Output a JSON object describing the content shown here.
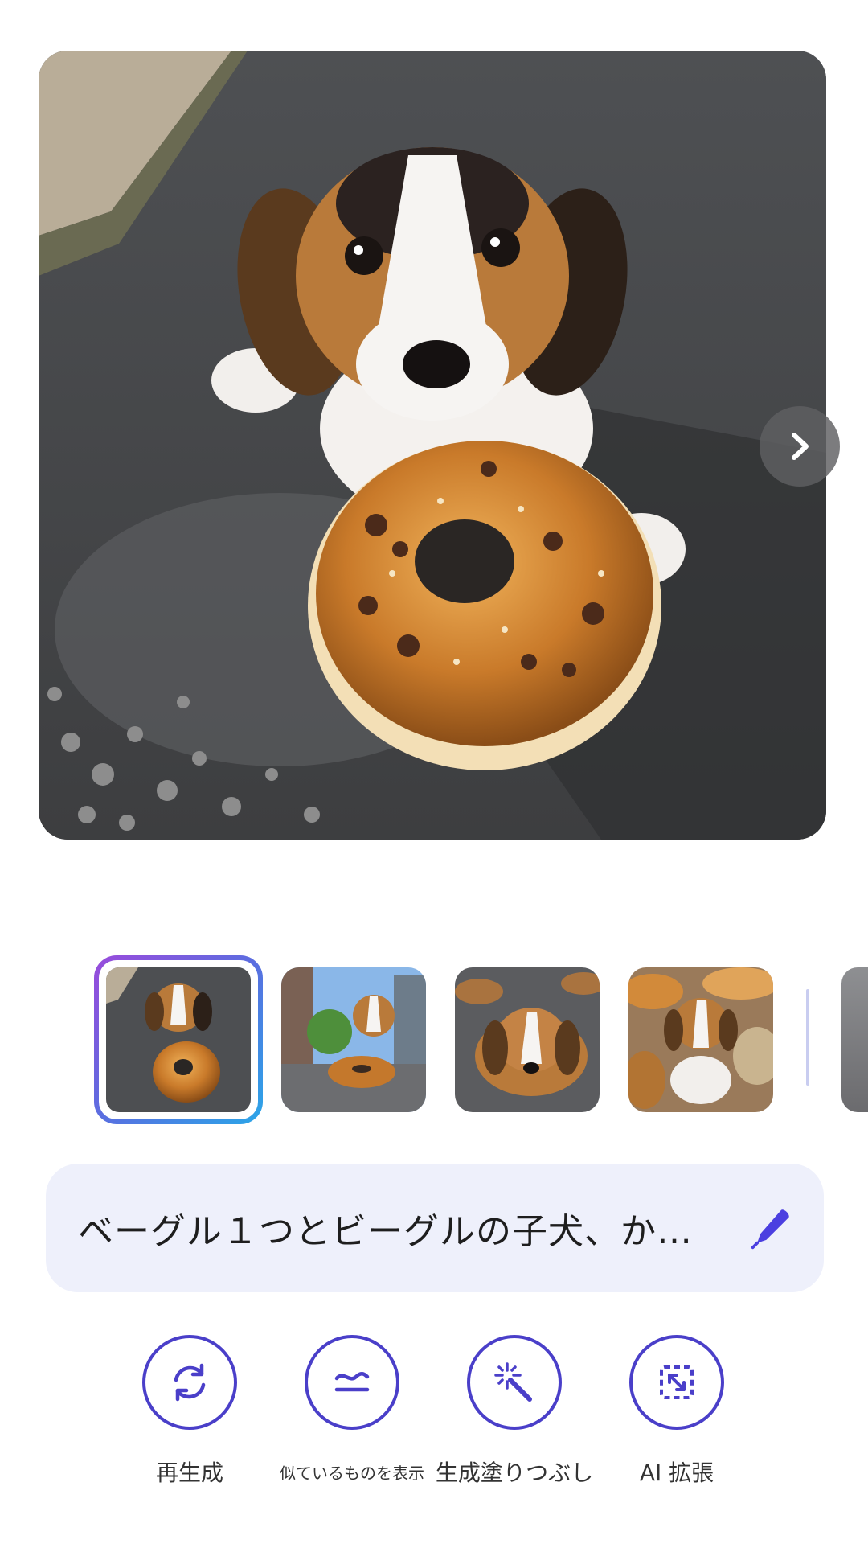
{
  "main_image": {
    "next_icon": "chevron-right-icon"
  },
  "thumbnails": [
    {
      "selected": true
    },
    {
      "selected": false
    },
    {
      "selected": false
    },
    {
      "selected": false
    },
    {
      "selected": false
    }
  ],
  "prompt": {
    "text": "ベーグル１つとビーグルの子犬、か…",
    "edit_icon": "pencil-icon"
  },
  "actions": [
    {
      "label": "再生成",
      "icon": "refresh-icon"
    },
    {
      "label": "似ているものを表示",
      "icon": "approx-equal-icon"
    },
    {
      "label": "生成塗りつぶし",
      "icon": "magic-wand-icon"
    },
    {
      "label": "AI 拡張",
      "icon": "expand-icon"
    }
  ],
  "colors": {
    "accent": "#4a3fc9",
    "prompt_bg": "#eef0fb",
    "ring_start": "#9a4bdc",
    "ring_end": "#2aa6e8"
  }
}
